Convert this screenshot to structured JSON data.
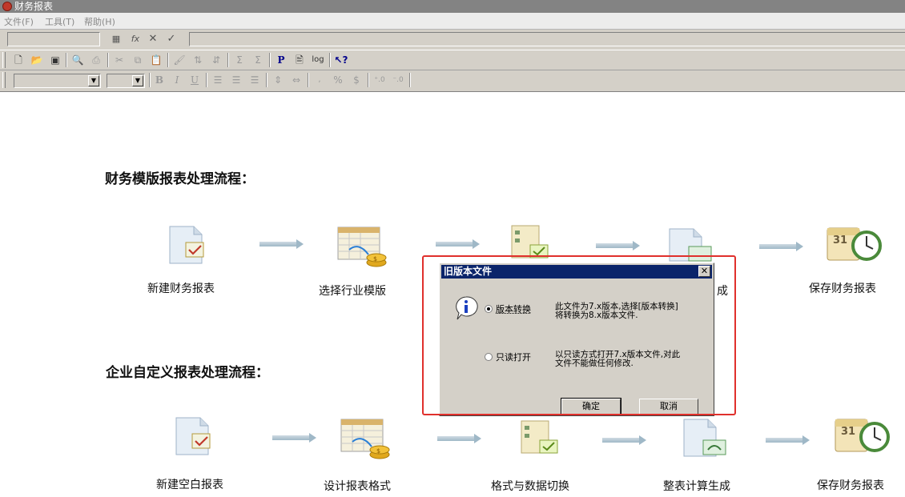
{
  "window": {
    "title": "财务报表"
  },
  "menu": {
    "items": [
      "文件(F)",
      "工具(T)",
      "帮助(H)"
    ]
  },
  "formula_bar": {
    "fx_symbol": "fx",
    "cancel": "✕",
    "confirm": "✓"
  },
  "format_toolbar": {
    "bold": "B",
    "italic": "I",
    "underline": "U",
    "percent": "%",
    "currency": "$"
  },
  "toolbar": {
    "p_label": "P",
    "log_label": "log"
  },
  "sections": {
    "template_flow": {
      "title": "财务模版报表处理流程：",
      "steps": [
        "新建财务报表",
        "选择行业模版",
        "",
        "成",
        "保存财务报表"
      ]
    },
    "custom_flow": {
      "title": "企业自定义报表处理流程：",
      "steps": [
        "新建空白报表",
        "设计报表格式",
        "格式与数据切换",
        "整表计算生成",
        "保存财务报表"
      ]
    }
  },
  "dialog": {
    "title": "旧版本文件",
    "close": "✕",
    "option1": {
      "label": "版本转换",
      "desc_line1": "此文件为7.x版本,选择[版本转换]",
      "desc_line2": "将转换为8.x版本文件.",
      "selected": true
    },
    "option2": {
      "label": "只读打开",
      "desc_line1": "以只读方式打开7.x版本文件,对此",
      "desc_line2": "文件不能做任何修改.",
      "selected": false
    },
    "ok": "确定",
    "cancel": "取消"
  },
  "colors": {
    "highlight_border": "#e0302c",
    "dialog_title_bg": "#0a246a"
  }
}
